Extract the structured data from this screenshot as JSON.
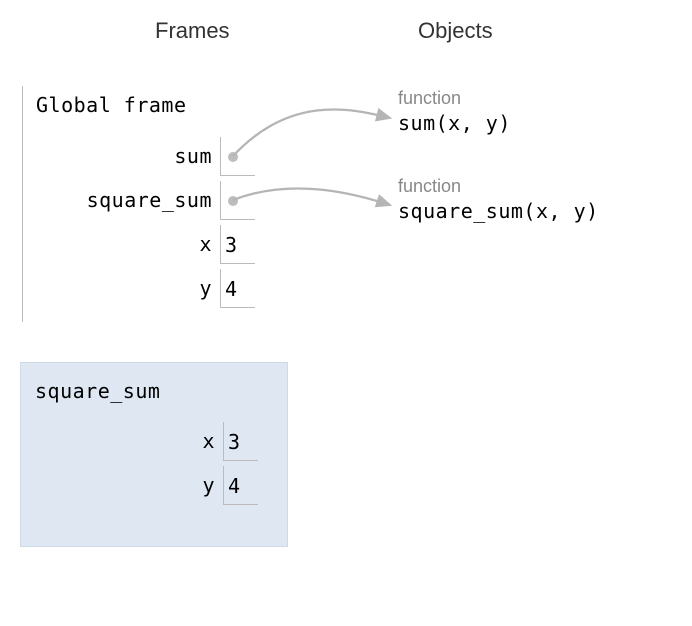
{
  "headings": {
    "frames": "Frames",
    "objects": "Objects"
  },
  "global_frame": {
    "title": "Global frame",
    "rows": [
      {
        "label": "sum",
        "kind": "pointer"
      },
      {
        "label": "square_sum",
        "kind": "pointer"
      },
      {
        "label": "x",
        "kind": "value",
        "value": "3"
      },
      {
        "label": "y",
        "kind": "value",
        "value": "4"
      }
    ]
  },
  "objects": [
    {
      "type": "function",
      "signature": "sum(x, y)"
    },
    {
      "type": "function",
      "signature": "square_sum(x, y)"
    }
  ],
  "local_frame": {
    "name": "square_sum",
    "rows": [
      {
        "label": "x",
        "value": "3"
      },
      {
        "label": "y",
        "value": "4"
      }
    ]
  }
}
